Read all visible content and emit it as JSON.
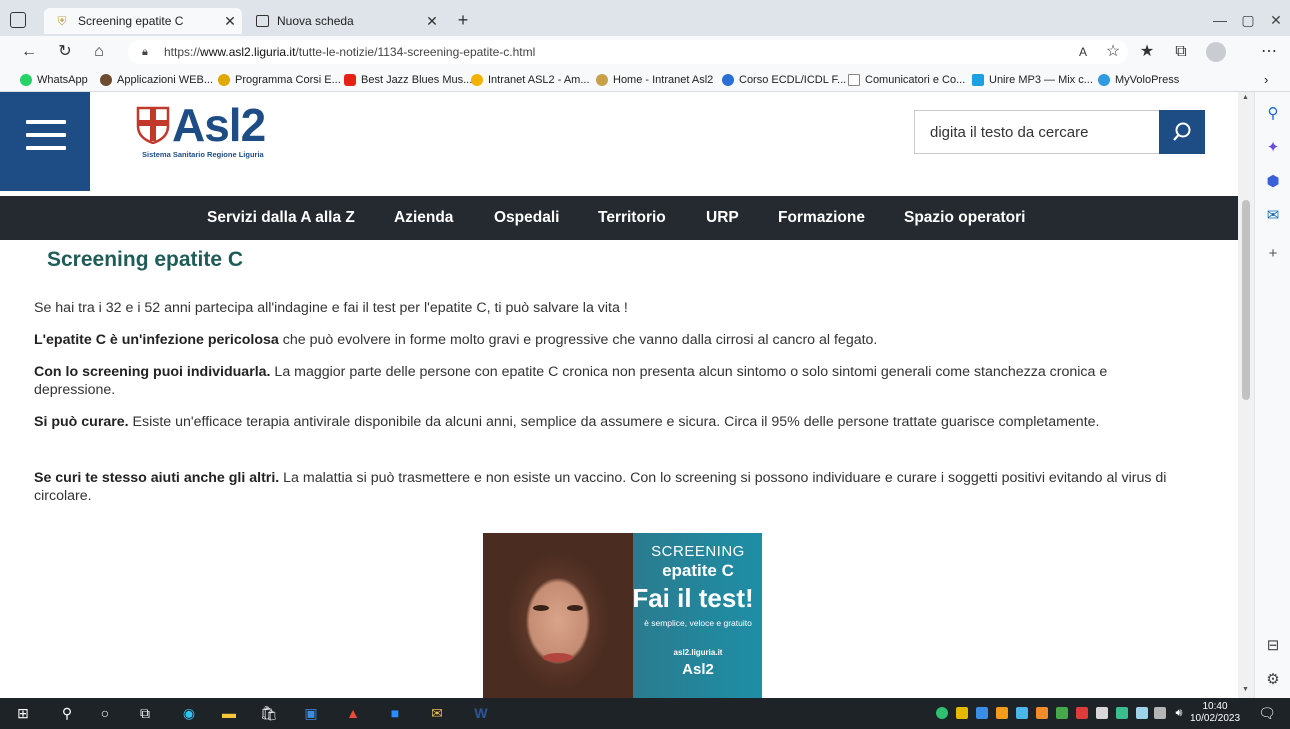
{
  "browser": {
    "tabs": [
      {
        "label": "Screening epatite C",
        "active": true
      },
      {
        "label": "Nuova scheda",
        "active": false
      }
    ],
    "new_tab_label": "+",
    "url_prefix": "https://",
    "url_host": "www.asl2.liguria.it",
    "url_path": "/tutte-le-notizie/1134-screening-epatite-c.html",
    "bookmarks": [
      {
        "label": "WhatsApp",
        "color": "#25d366"
      },
      {
        "label": "Applicazioni WEB...",
        "color": "#6d4c2f"
      },
      {
        "label": "Programma Corsi E...",
        "color": "#e0a800"
      },
      {
        "label": "Best Jazz Blues Mus...",
        "color": "#e62117"
      },
      {
        "label": "Intranet ASL2 - Am...",
        "color": "#f2b300"
      },
      {
        "label": "Home - Intranet Asl2",
        "color": "#c8a04a"
      },
      {
        "label": "Corso ECDL/ICDL F...",
        "color": "#2a6fd6"
      },
      {
        "label": "Comunicatori e Co...",
        "color": "#888888"
      },
      {
        "label": "Unire MP3 — Mix c...",
        "color": "#1ba1e2"
      },
      {
        "label": "MyVoloPress",
        "color": "#2e9be0"
      }
    ]
  },
  "site": {
    "logo_text": "Asl",
    "logo_number": "2",
    "logo_subtitle": "Sistema Sanitario Regione Liguria",
    "search_placeholder": "digita il testo da cercare",
    "nav": [
      "Servizi dalla A alla Z",
      "Azienda",
      "Ospedali",
      "Territorio",
      "URP",
      "Formazione",
      "Spazio operatori"
    ]
  },
  "article": {
    "title": "Screening epatite C",
    "intro": "Se hai tra i 32 e i 52 anni partecipa all'indagine e fai il test per l'epatite C, ti può salvare la vita !",
    "p1_bold": "L'epatite C è un'infezione pericolosa",
    "p1_text": " che può evolvere in forme molto gravi e progressive che vanno dalla cirrosi al cancro al fegato.",
    "p2_bold": "Con lo screening puoi individuarla.",
    "p2_text": " La maggior parte delle persone con epatite C cronica non presenta alcun sintomo o solo sintomi generali come stanchezza cronica e depressione.",
    "p3_bold": "Si può curare.",
    "p3_text": " Esiste un'efficace terapia antivirale disponibile da alcuni anni, semplice da assumere e sicura. Circa il 95% delle persone trattate guarisce completamente.",
    "p4_bold": "Se curi te stesso aiuti anche gli altri.",
    "p4_text": " La malattia si può trasmettere e non esiste un vaccino. Con lo screening si possono individuare e curare i soggetti positivi evitando al virus di circolare."
  },
  "banner": {
    "line1": "SCREENING",
    "line2": "epatite C",
    "line3": "Fai il test!",
    "line4": "è semplice, veloce e gratuito",
    "line5": "asl2.liguria.it",
    "line6": "Asl2"
  },
  "taskbar": {
    "time": "10:40",
    "date": "10/02/2023"
  }
}
